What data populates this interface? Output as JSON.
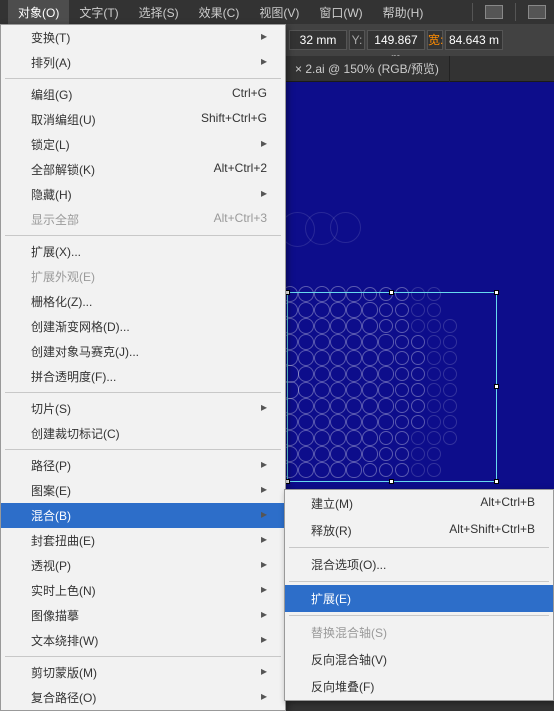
{
  "menubar": {
    "items": [
      "对象(O)",
      "文字(T)",
      "选择(S)",
      "效果(C)",
      "视图(V)",
      "窗口(W)",
      "帮助(H)"
    ]
  },
  "toolbar": {
    "x_suffix": "32 mm",
    "y_label": "Y:",
    "y_value": "149.867 m",
    "w_label": "宽:",
    "w_value": "84.643 m"
  },
  "tab": {
    "close": "×",
    "title": "2.ai @ 150% (RGB/预览)"
  },
  "menu": {
    "transform": "变换(T)",
    "arrange": "排列(A)",
    "group": "编组(G)",
    "group_sc": "Ctrl+G",
    "ungroup": "取消编组(U)",
    "ungroup_sc": "Shift+Ctrl+G",
    "lock": "锁定(L)",
    "unlock_all": "全部解锁(K)",
    "unlock_all_sc": "Alt+Ctrl+2",
    "hide": "隐藏(H)",
    "show_all": "显示全部",
    "show_all_sc": "Alt+Ctrl+3",
    "expand": "扩展(X)...",
    "expand_appearance": "扩展外观(E)",
    "rasterize": "栅格化(Z)...",
    "gradient_mesh": "创建渐变网格(D)...",
    "mosaic": "创建对象马赛克(J)...",
    "flatten": "拼合透明度(F)...",
    "slice": "切片(S)",
    "trim_marks": "创建裁切标记(C)",
    "path": "路径(P)",
    "pattern": "图案(E)",
    "blend": "混合(B)",
    "envelope": "封套扭曲(E)",
    "perspective": "透视(P)",
    "live_paint": "实时上色(N)",
    "image_trace": "图像描摹",
    "text_wrap": "文本绕排(W)",
    "clipping_mask": "剪切蒙版(M)",
    "compound_path": "复合路径(O)",
    "arr": "▸"
  },
  "submenu": {
    "make": "建立(M)",
    "make_sc": "Alt+Ctrl+B",
    "release": "释放(R)",
    "release_sc": "Alt+Shift+Ctrl+B",
    "options": "混合选项(O)...",
    "expand": "扩展(E)",
    "replace_spine": "替换混合轴(S)",
    "reverse_spine": "反向混合轴(V)",
    "reverse_front": "反向堆叠(F)"
  }
}
